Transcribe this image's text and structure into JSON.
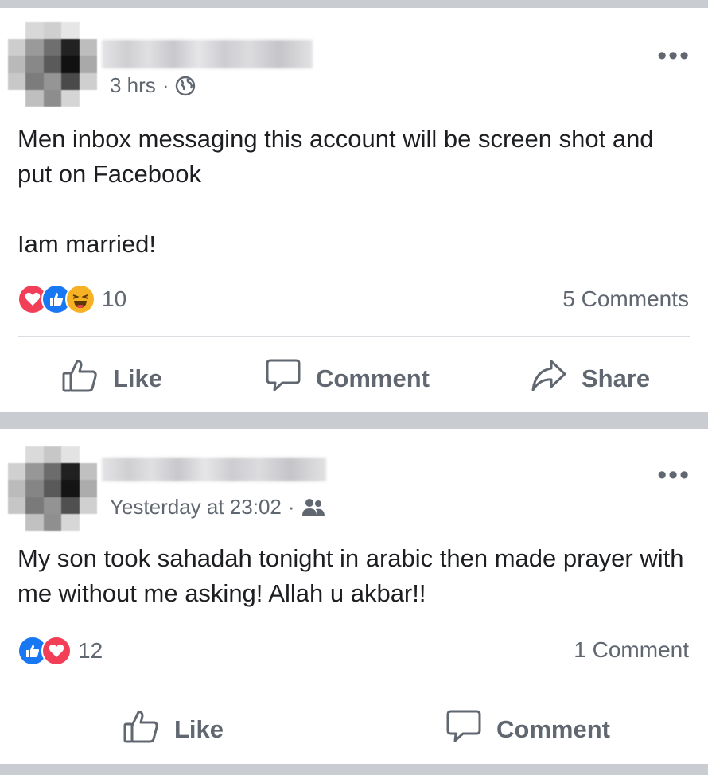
{
  "posts": [
    {
      "timestamp": "3 hrs",
      "separator": "·",
      "audience_icon": "globe-icon",
      "more_label": "•••",
      "lines": [
        "Men inbox messaging this account will be screen shot and put on Facebook"
      ],
      "extra_line": "Iam married!",
      "reactions": [
        "love",
        "like",
        "haha"
      ],
      "reaction_count": "10",
      "comments_count": "5 Comments",
      "actions": {
        "like": "Like",
        "comment": "Comment",
        "share": "Share"
      }
    },
    {
      "timestamp": "Yesterday at 23:02",
      "separator": "·",
      "audience_icon": "friends-icon",
      "more_label": "•••",
      "lines": [
        "My son took sahadah tonight in arabic then made prayer with me without me asking! Allah u akbar!!"
      ],
      "reactions": [
        "like",
        "love"
      ],
      "reaction_count": "12",
      "comments_count": "1 Comment",
      "actions": {
        "like": "Like",
        "comment": "Comment"
      }
    }
  ],
  "colors": {
    "feed_background": "#c9ccd1",
    "card_background": "#ffffff",
    "secondary_text": "#606770",
    "like_blue": "#1877f2",
    "love_red": "#f33e58",
    "haha_yellow": "#f7b125"
  }
}
